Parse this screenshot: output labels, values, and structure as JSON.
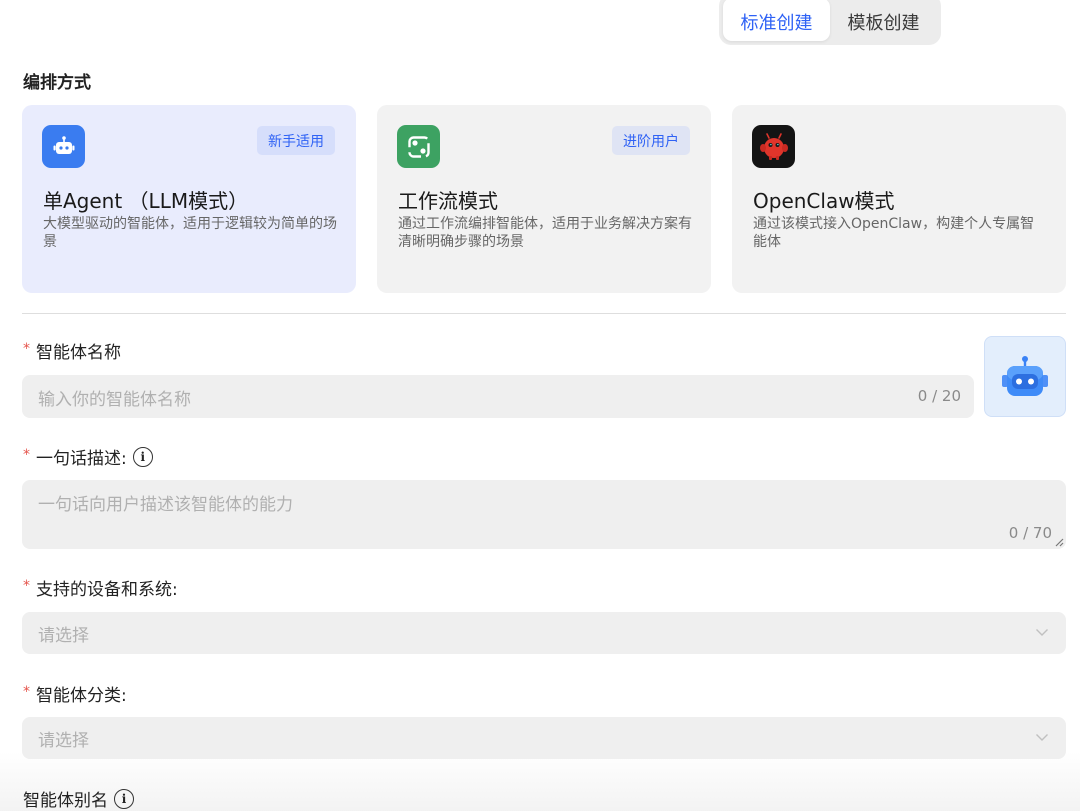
{
  "mode_tabs": [
    {
      "label": "标准创建",
      "active": true
    },
    {
      "label": "模板创建",
      "active": false
    }
  ],
  "orchestration": {
    "title": "编排方式",
    "cards": [
      {
        "icon": "robot-icon",
        "badge": "新手适用",
        "title": "单Agent （LLM模式）",
        "desc": "大模型驱动的智能体，适用于逻辑较为简单的场景",
        "selected": true
      },
      {
        "icon": "workflow-icon",
        "badge": "进阶用户",
        "title": "工作流模式",
        "desc": "通过工作流编排智能体，适用于业务解决方案有清晰明确步骤的场景",
        "selected": false
      },
      {
        "icon": "openclaw-icon",
        "badge": "",
        "title": "OpenClaw模式",
        "desc": "通过该模式接入OpenClaw，构建个人专属智能体",
        "selected": false
      }
    ]
  },
  "form": {
    "name": {
      "required_mark": "*",
      "label": "智能体名称",
      "placeholder": "输入你的智能体名称",
      "counter": "0 / 20"
    },
    "description": {
      "required_mark": "*",
      "label": "一句话描述:",
      "placeholder": "一句话向用户描述该智能体的能力",
      "counter": "0 / 70"
    },
    "devices": {
      "required_mark": "*",
      "label": "支持的设备和系统:",
      "placeholder": "请选择"
    },
    "category": {
      "required_mark": "*",
      "label": "智能体分类:",
      "placeholder": "请选择"
    },
    "alias": {
      "label": "智能体别名"
    }
  },
  "colors": {
    "accent": "#2f62f5",
    "selected_card": "#e9ecfd",
    "required": "#e5534b",
    "workflow_green": "#3da262",
    "robot_blue": "#3a7cf0"
  }
}
